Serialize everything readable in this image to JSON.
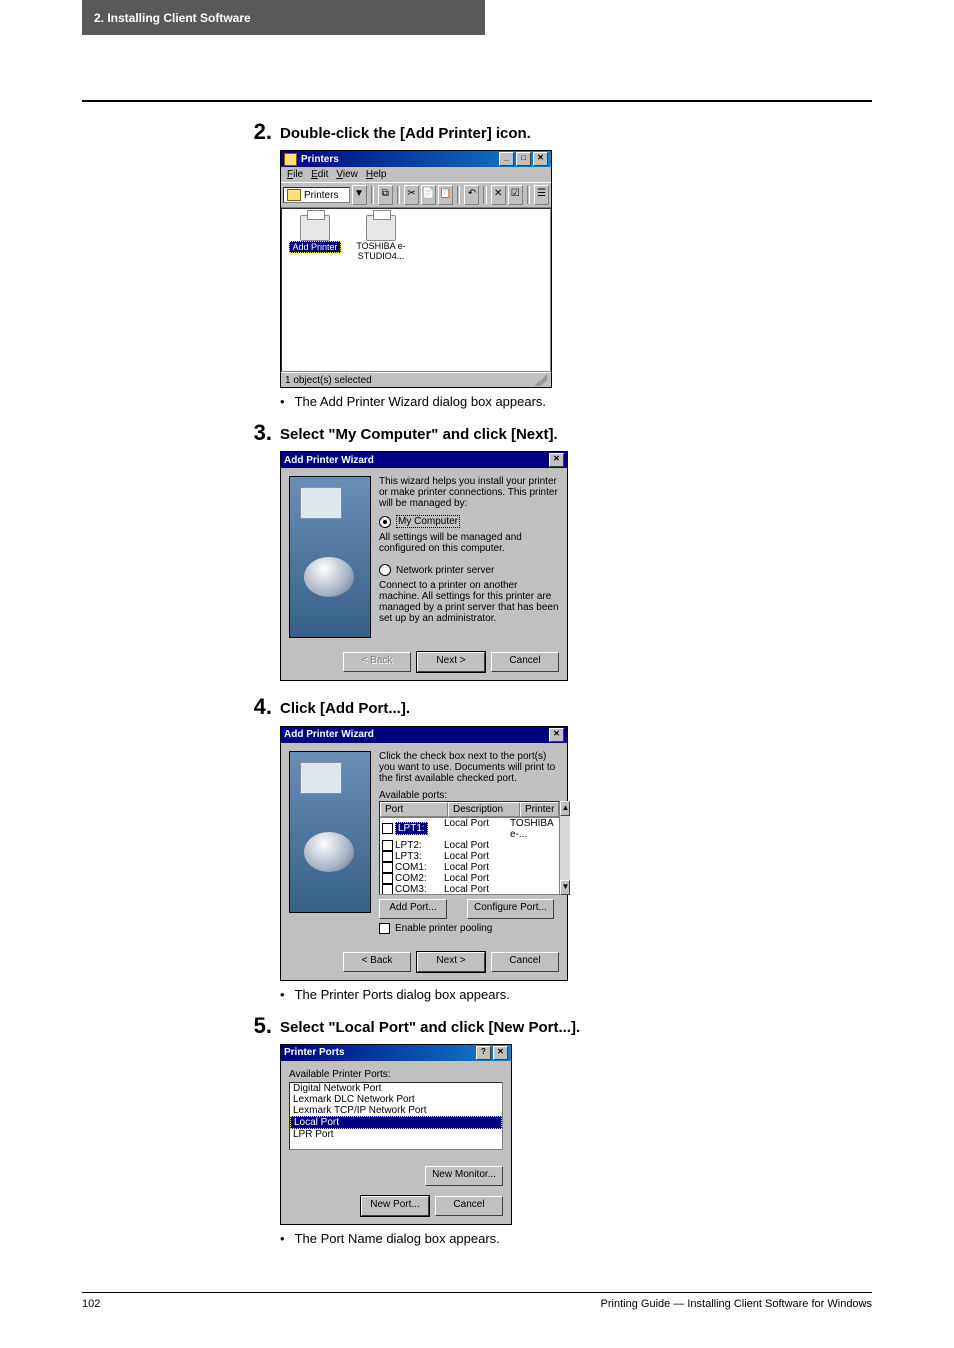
{
  "header": {
    "title": "2. Installing Client Software"
  },
  "steps": [
    {
      "num": "2.",
      "title": "Double-click the [Add Printer] icon."
    },
    {
      "num": "3.",
      "title": "Select \"My Computer\" and click [Next]."
    },
    {
      "num": "4.",
      "title": "Click [Add Port...]."
    },
    {
      "num": "5.",
      "title": "Select \"Local Port\" and click [New Port...]."
    }
  ],
  "bullets": {
    "after2": "The Add Printer Wizard dialog box appears.",
    "after4": "The Printer Ports dialog box appears.",
    "after5": "The Port Name dialog box appears."
  },
  "shot1": {
    "title": "Printers",
    "menus": [
      "File",
      "Edit",
      "View",
      "Help"
    ],
    "addrLabel": "Printers",
    "toolbar_glyphs": [
      "▼",
      "⧉",
      "✂",
      "📄",
      "📋",
      "↶",
      "✕",
      "☑",
      "☰"
    ],
    "items": [
      {
        "label": "Add Printer",
        "selected": true
      },
      {
        "label": "TOSHIBA e-STUDIO4...",
        "selected": false
      }
    ],
    "status": "1 object(s) selected",
    "ctrl": {
      "min": "_",
      "max": "□",
      "close": "✕"
    }
  },
  "shot2": {
    "title": "Add Printer Wizard",
    "close": "✕",
    "intro": "This wizard helps you install your printer or make printer connections. This printer will be managed by:",
    "opt1": "My Computer",
    "opt1_desc": "All settings will be managed and configured on this computer.",
    "opt2": "Network printer server",
    "opt2_desc": "Connect to a printer on another machine. All settings for this printer are managed by a print server that has been set up by an administrator.",
    "btn_back": "< Back",
    "btn_next": "Next >",
    "btn_cancel": "Cancel"
  },
  "shot3": {
    "title": "Add Printer Wizard",
    "close": "✕",
    "intro": "Click the check box next to the port(s) you want to use. Documents will print to the first available checked port.",
    "avail": "Available ports:",
    "headers": [
      "Port",
      "Description",
      "Printer"
    ],
    "rows": [
      {
        "port": "LPT1:",
        "desc": "Local Port",
        "printer": "TOSHIBA e-...",
        "sel": true
      },
      {
        "port": "LPT2:",
        "desc": "Local Port",
        "printer": "",
        "sel": false
      },
      {
        "port": "LPT3:",
        "desc": "Local Port",
        "printer": "",
        "sel": false
      },
      {
        "port": "COM1:",
        "desc": "Local Port",
        "printer": "",
        "sel": false
      },
      {
        "port": "COM2:",
        "desc": "Local Port",
        "printer": "",
        "sel": false
      },
      {
        "port": "COM3:",
        "desc": "Local Port",
        "printer": "",
        "sel": false
      }
    ],
    "scroll_up": "▲",
    "scroll_down": "▼",
    "btn_addport": "Add Port...",
    "btn_configport": "Configure Port...",
    "chk_pool": "Enable printer pooling",
    "btn_back": "< Back",
    "btn_next": "Next >",
    "btn_cancel": "Cancel"
  },
  "shot4": {
    "title": "Printer Ports",
    "help": "?",
    "close": "✕",
    "avail": "Available Printer Ports:",
    "list": [
      "Digital Network Port",
      "Lexmark DLC Network Port",
      "Lexmark TCP/IP Network Port",
      "Local Port",
      "LPR Port"
    ],
    "sel_index": 3,
    "btn_newmon": "New Monitor...",
    "btn_newport": "New Port...",
    "btn_cancel": "Cancel"
  },
  "footer": {
    "page": "102",
    "right": "Printing Guide — Installing Client Software for Windows"
  }
}
